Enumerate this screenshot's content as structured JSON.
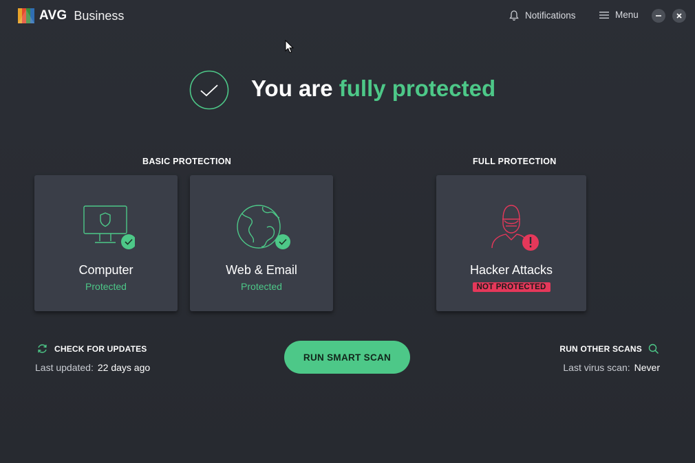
{
  "app": {
    "brand": "AVG",
    "product": "Business"
  },
  "titlebar": {
    "notifications_label": "Notifications",
    "menu_label": "Menu"
  },
  "hero": {
    "title_prefix": "You are ",
    "title_accent": "fully protected"
  },
  "sections": {
    "basic_label": "BASIC PROTECTION",
    "full_label": "FULL PROTECTION"
  },
  "cards": [
    {
      "title": "Computer",
      "status": "Protected",
      "icon": "monitor-shield-icon"
    },
    {
      "title": "Web & Email",
      "status": "Protected",
      "icon": "globe-icon"
    },
    {
      "title": "Hacker Attacks",
      "status": "NOT PROTECTED",
      "icon": "hacker-icon"
    }
  ],
  "updates": {
    "label": "CHECK FOR UPDATES",
    "last_updated_label": "Last updated:",
    "last_updated_value": "22 days ago"
  },
  "scan": {
    "button_label": "RUN SMART SCAN",
    "other_label": "RUN OTHER SCANS",
    "last_scan_label": "Last virus scan:",
    "last_scan_value": "Never"
  },
  "colors": {
    "accent_green": "#4dc888",
    "alert_red": "#e5385a",
    "background": "#2a2d33",
    "card": "#3a3e48"
  }
}
